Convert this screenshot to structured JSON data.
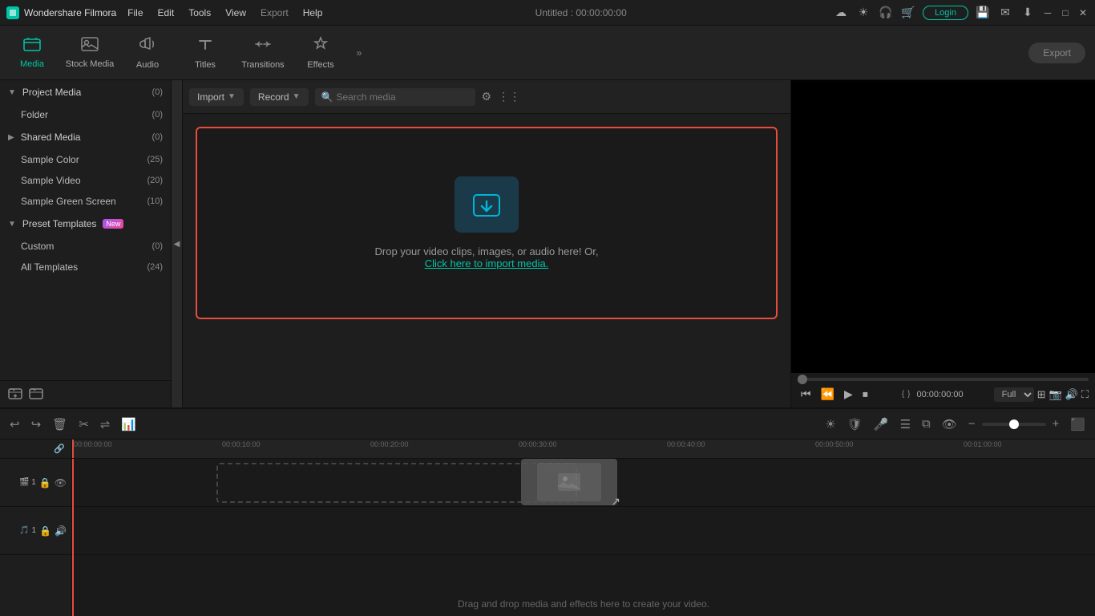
{
  "app": {
    "name": "Wondershare Filmora",
    "logo_color": "#00c4a7",
    "title": "Untitled : 00:00:00:00"
  },
  "titlebar": {
    "menu_items": [
      "File",
      "Edit",
      "Tools",
      "View",
      "Export",
      "Help"
    ],
    "export_label": "Export",
    "login_label": "Login",
    "icons": [
      "cloud",
      "sun",
      "headset",
      "cart"
    ]
  },
  "toolbar": {
    "items": [
      {
        "id": "media",
        "label": "Media",
        "icon": "⬜",
        "active": true
      },
      {
        "id": "stock",
        "label": "Stock Media",
        "icon": "▦"
      },
      {
        "id": "audio",
        "label": "Audio",
        "icon": "♪"
      },
      {
        "id": "titles",
        "label": "Titles",
        "icon": "T"
      },
      {
        "id": "transitions",
        "label": "Transitions",
        "icon": "⇄"
      },
      {
        "id": "effects",
        "label": "Effects",
        "icon": "✦"
      }
    ],
    "more_icon": "»",
    "export_btn": "Export"
  },
  "sidebar": {
    "project_media": {
      "label": "Project Media",
      "count": 0,
      "children": [
        {
          "label": "Folder",
          "count": 0
        }
      ]
    },
    "shared_media": {
      "label": "Shared Media",
      "count": 0
    },
    "sample_items": [
      {
        "label": "Sample Color",
        "count": 25
      },
      {
        "label": "Sample Video",
        "count": 20
      },
      {
        "label": "Sample Green Screen",
        "count": 10
      }
    ],
    "preset_templates": {
      "label": "Preset Templates",
      "badge": "New",
      "children": [
        {
          "label": "Custom",
          "count": 0
        },
        {
          "label": "All Templates",
          "count": 24
        }
      ]
    },
    "bottom_icons": [
      "add-folder",
      "folder-open"
    ]
  },
  "content": {
    "import_label": "Import",
    "record_label": "Record",
    "search_placeholder": "Search media",
    "drop_text": "Drop your video clips, images, or audio here! Or,",
    "drop_link": "Click here to import media.",
    "icons": [
      "filter",
      "grid"
    ]
  },
  "preview": {
    "time_display": "00:00:00:00",
    "quality": "Full",
    "controls": {
      "prev_frame": "⏮",
      "back_5": "⏪",
      "play": "▶",
      "stop": "⏹"
    }
  },
  "timeline": {
    "toolbar_btns": [
      "↩",
      "↪",
      "🗑",
      "✂",
      "⇌",
      "📊"
    ],
    "markers": [
      "00:00:00:00",
      "00:00:10:00",
      "00:00:20:00",
      "00:00:30:00",
      "00:00:40:00",
      "00:00:50:00",
      "00:01:00:00"
    ],
    "drop_hint": "Drag and drop media and effects here to create your video.",
    "tracks": [
      {
        "type": "video",
        "icon": "🎬",
        "num": 1
      },
      {
        "type": "audio",
        "icon": "🎵",
        "num": 1
      }
    ],
    "right_controls": [
      "sun",
      "shield",
      "mic",
      "list",
      "layers",
      "eye",
      "zoom-out",
      "zoom-in",
      "bar",
      "expand"
    ]
  }
}
